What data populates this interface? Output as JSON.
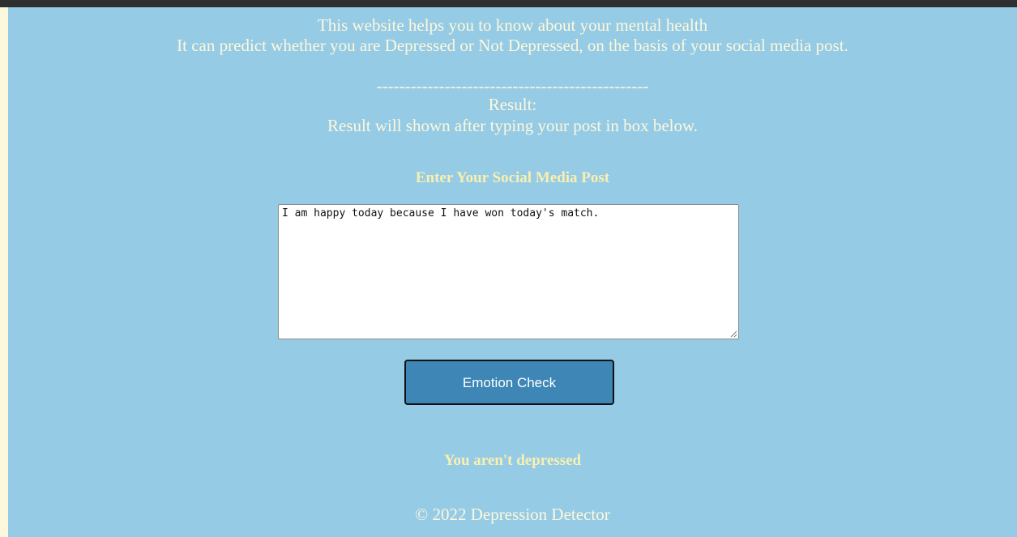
{
  "intro": {
    "line1": "This website helps you to know about your mental health",
    "line2": "It can predict whether you are Depressed or Not Depressed, on the basis of your social media post."
  },
  "divider": "------------------------------------------------",
  "result": {
    "label": "Result:",
    "hint": "Result will shown after typing your post in box below."
  },
  "form": {
    "heading": "Enter Your Social Media Post",
    "post_value": "I am happy today because I have won today's match.",
    "submit_label": "Emotion Check"
  },
  "verdict": "You aren't depressed",
  "footer": "© 2022 Depression Detector",
  "colors": {
    "background": "#96cbe6",
    "text": "#fdf8dc",
    "heading_text": "#f8f0b0",
    "button": "#3d86b5",
    "outer_margin": "#fdf8dc",
    "top_bar": "#2f2f2f"
  }
}
